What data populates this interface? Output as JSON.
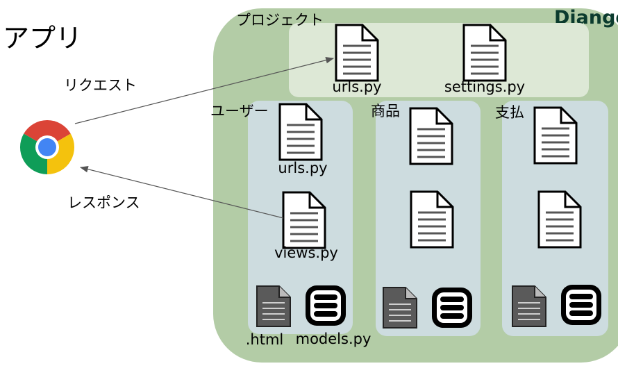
{
  "app_label": "アプリ",
  "request_label": "リクエスト",
  "response_label": "レスポンス",
  "django_logo": "Django",
  "project": {
    "title": "プロジェクト",
    "files": [
      "urls.py",
      "settings.py"
    ]
  },
  "apps": [
    {
      "title": "ユーザー",
      "files": [
        "urls.py",
        "views.py"
      ],
      "template_label": ".html",
      "models_label": "models.py"
    },
    {
      "title": "商品",
      "files": [
        "",
        ""
      ],
      "template_label": "",
      "models_label": ""
    },
    {
      "title": "支払",
      "files": [
        "",
        ""
      ],
      "template_label": "",
      "models_label": ""
    }
  ],
  "icons": {
    "browser": "chrome-browser-icon",
    "file": "document-icon",
    "template": "html-template-icon",
    "models": "database-icon"
  },
  "colors": {
    "django_area": "#b3cca6",
    "project_area": "#dde8d6",
    "app_area": "#cddcdf",
    "django_text": "#0b3b2e",
    "arrow": "#555555"
  }
}
